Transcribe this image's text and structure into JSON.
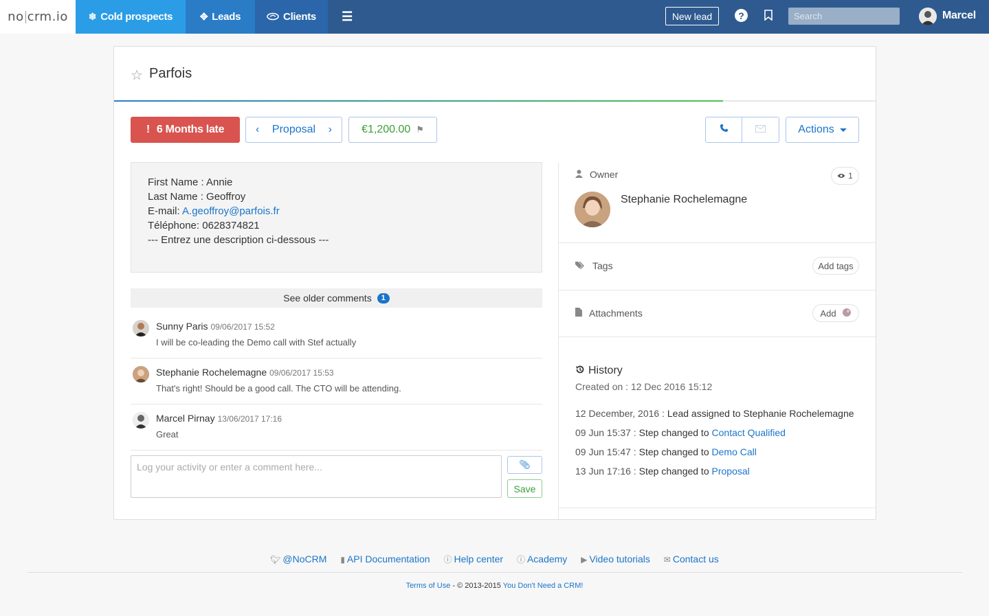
{
  "nav": {
    "logo_left": "no",
    "logo_right": "crm.io",
    "tabs": [
      {
        "label": "Cold prospects",
        "icon": "snowflake-icon"
      },
      {
        "label": "Leads",
        "icon": "crosshair-icon"
      },
      {
        "label": "Clients",
        "icon": "handshake-icon"
      }
    ],
    "menu_icon": "hamburger-icon",
    "new_lead": "New lead",
    "search_placeholder": "Search",
    "user_name": "Marcel"
  },
  "lead": {
    "title": "Parfois",
    "late_label": "6 Months late",
    "step_label": "Proposal",
    "amount": "€1,200.00",
    "progress_percent": 80,
    "actions_label": "Actions"
  },
  "description": {
    "lines": [
      "First Name : Annie",
      "Last Name : Geoffroy"
    ],
    "email_label": "E-mail: ",
    "email_value": "A.geoffroy@parfois.fr",
    "phone_line": "Téléphone: 0628374821",
    "separator_line": "--- Entrez une description ci-dessous ---"
  },
  "comments": {
    "older_label": "See older comments",
    "older_count": "1",
    "items": [
      {
        "author": "Sunny Paris",
        "date": "09/06/2017 15:52",
        "text": "I will be co-leading the Demo call with Stef actually"
      },
      {
        "author": "Stephanie Rochelemagne",
        "date": "09/06/2017 15:53",
        "text": "That's right! Should be a good call. The CTO will be attending."
      },
      {
        "author": "Marcel Pirnay",
        "date": "13/06/2017 17:16",
        "text": "Great"
      }
    ],
    "input_placeholder": "Log your activity or enter a comment here...",
    "save_label": "Save"
  },
  "sidebar": {
    "owner_label": "Owner",
    "views_count": "1",
    "owner_name": "Stephanie Rochelemagne",
    "tags_label": "Tags",
    "add_tags_label": "Add tags",
    "attachments_label": "Attachments",
    "add_label": "Add",
    "history_title": "History",
    "created_on": "Created on : 12 Dec 2016 15:12",
    "history": [
      {
        "date": "12 December, 2016 :",
        "text": "Lead assigned to Stephanie Rochelemagne",
        "link": ""
      },
      {
        "date": "09 Jun 15:37 :",
        "text": "Step changed to",
        "link": "Contact Qualified"
      },
      {
        "date": "09 Jun 15:47 :",
        "text": "Step changed to",
        "link": "Demo Call"
      },
      {
        "date": "13 Jun 17:16 :",
        "text": "Step changed to",
        "link": "Proposal"
      }
    ]
  },
  "footer": {
    "links": [
      {
        "label": "@NoCRM",
        "icon": "twitter-icon"
      },
      {
        "label": "API Documentation",
        "icon": "book-icon"
      },
      {
        "label": "Help center",
        "icon": "info-icon"
      },
      {
        "label": "Academy",
        "icon": "info-icon"
      },
      {
        "label": "Video tutorials",
        "icon": "play-icon"
      },
      {
        "label": "Contact us",
        "icon": "envelope-icon"
      }
    ],
    "terms": "Terms of Use",
    "copyright_mid": " - © 2013-2015 ",
    "tagline": "You Don't Need a CRM!"
  },
  "colors": {
    "nav_bg": "#2e5a8f",
    "cold_tab": "#2b9de6",
    "leads_tab": "#2a7cc7",
    "clients_tab": "#2a66a9",
    "late": "#d9534f",
    "amount": "#3a9f3a",
    "link": "#1a75c9"
  }
}
